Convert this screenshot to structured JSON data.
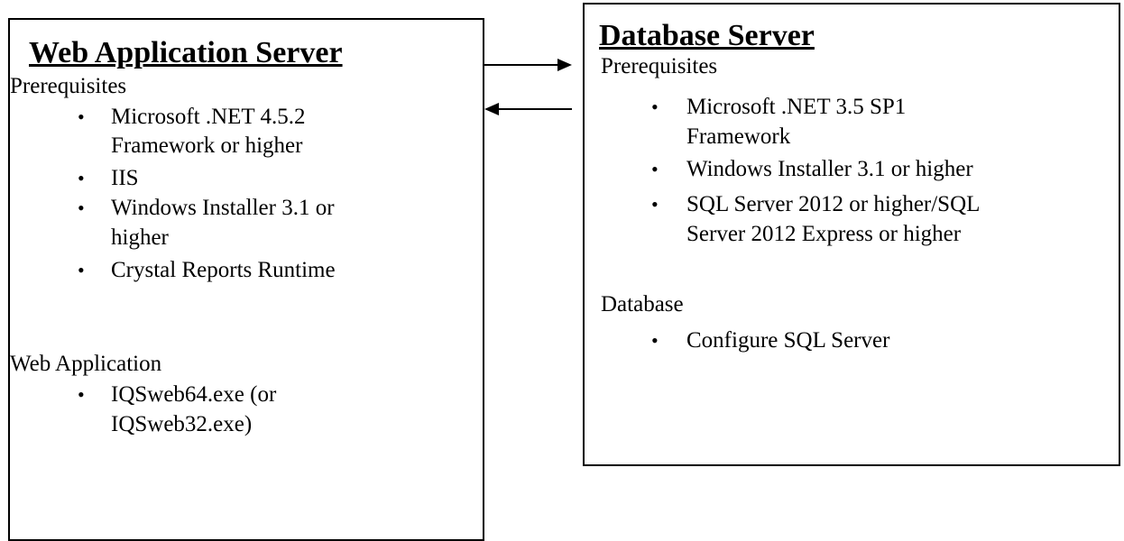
{
  "web_server": {
    "title": "Web Application Server",
    "prereq_heading": "Prerequisites",
    "prereq_items": [
      [
        "Microsoft .NET 4.5.2",
        "Framework or higher"
      ],
      [
        "IIS"
      ],
      [
        "Windows Installer 3.1 or",
        "higher"
      ],
      [
        "Crystal Reports Runtime"
      ]
    ],
    "app_heading": "Web Application",
    "app_items": [
      [
        "IQSweb64.exe (or",
        "IQSweb32.exe)"
      ]
    ]
  },
  "db_server": {
    "title": "Database Server",
    "prereq_heading": "Prerequisites",
    "prereq_items": [
      [
        "Microsoft .NET 3.5 SP1",
        "Framework"
      ],
      [
        "Windows Installer 3.1 or higher"
      ],
      [
        "SQL Server 2012 or higher/SQL",
        "Server 2012 Express or higher"
      ]
    ],
    "db_heading": "Database",
    "db_items": [
      [
        "Configure SQL Server"
      ]
    ]
  },
  "bullet_glyph": "•",
  "colors": {
    "line": "#000000",
    "background": "#ffffff"
  }
}
